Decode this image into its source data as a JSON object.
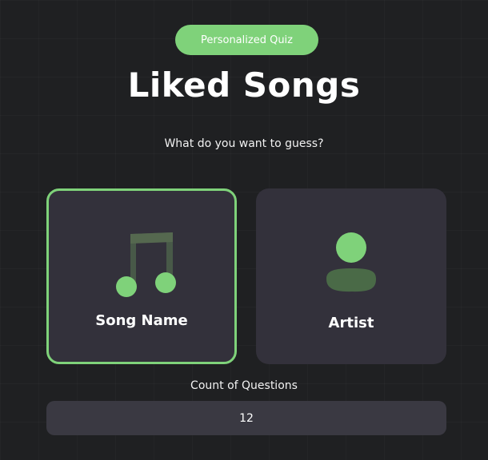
{
  "header": {
    "badge_label": "Personalized Quiz",
    "title": "Liked Songs",
    "subtitle": "What do you want to guess?"
  },
  "options": {
    "song": {
      "label": "Song Name",
      "icon": "music-note-icon",
      "selected": true
    },
    "artist": {
      "label": "Artist",
      "icon": "person-icon",
      "selected": false
    }
  },
  "count": {
    "label": "Count of Questions",
    "value": "12"
  },
  "colors": {
    "accent": "#7fd27a",
    "background": "#1f2022",
    "card": "#33313b",
    "input": "#3a3942"
  }
}
